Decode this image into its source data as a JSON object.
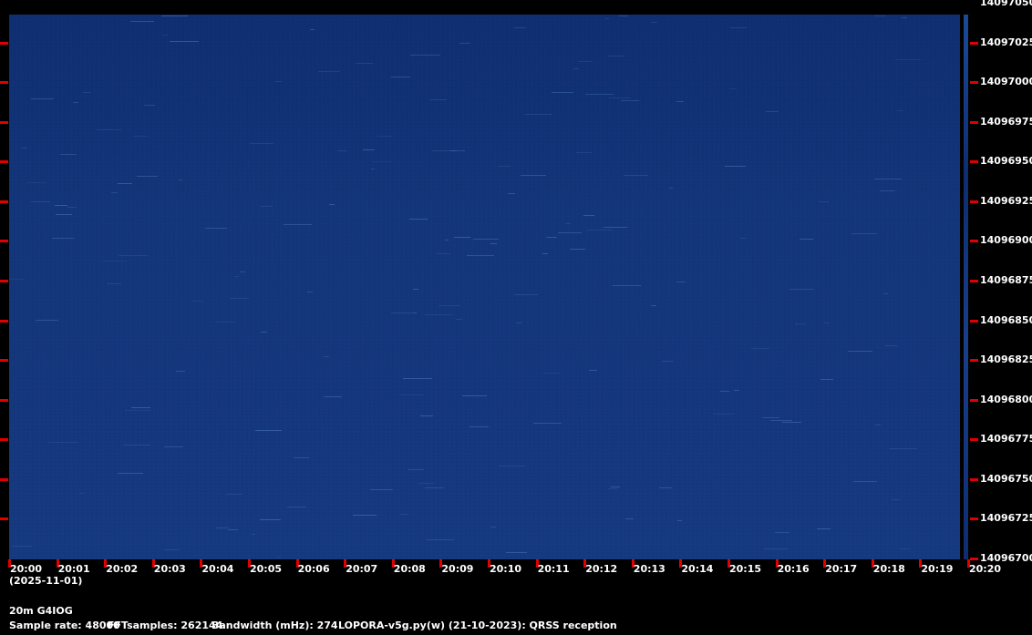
{
  "waterfall": {
    "frequency_labels": [
      "14097050",
      "14097025",
      "14097000",
      "14096975",
      "14096950",
      "14096925",
      "14096900",
      "14096875",
      "14096850",
      "14096825",
      "14096800",
      "14096775",
      "14096750",
      "14096725",
      "14096700"
    ],
    "time_labels": [
      "20:00",
      "20:01",
      "20:02",
      "20:03",
      "20:04",
      "20:05",
      "20:06",
      "20:07",
      "20:08",
      "20:09",
      "20:10",
      "20:11",
      "20:12",
      "20:13",
      "20:14",
      "20:15",
      "20:16",
      "20:17",
      "20:18",
      "20:19",
      "20:20"
    ],
    "date": "(2025-11-01)",
    "colors": {
      "background": "#000000",
      "waterfall": "#14367c",
      "ticks": "#e00000",
      "text": "#ffffff"
    }
  },
  "footer": {
    "station": "20m G4IOG",
    "sample_rate": "Sample rate: 48000",
    "fft_samples": "FFTsamples: 262144",
    "bandwidth": "Bandwidth (mHz): 274",
    "software": "LOPORA-v5g.py(w) (21-10-2023): QRSS reception"
  }
}
